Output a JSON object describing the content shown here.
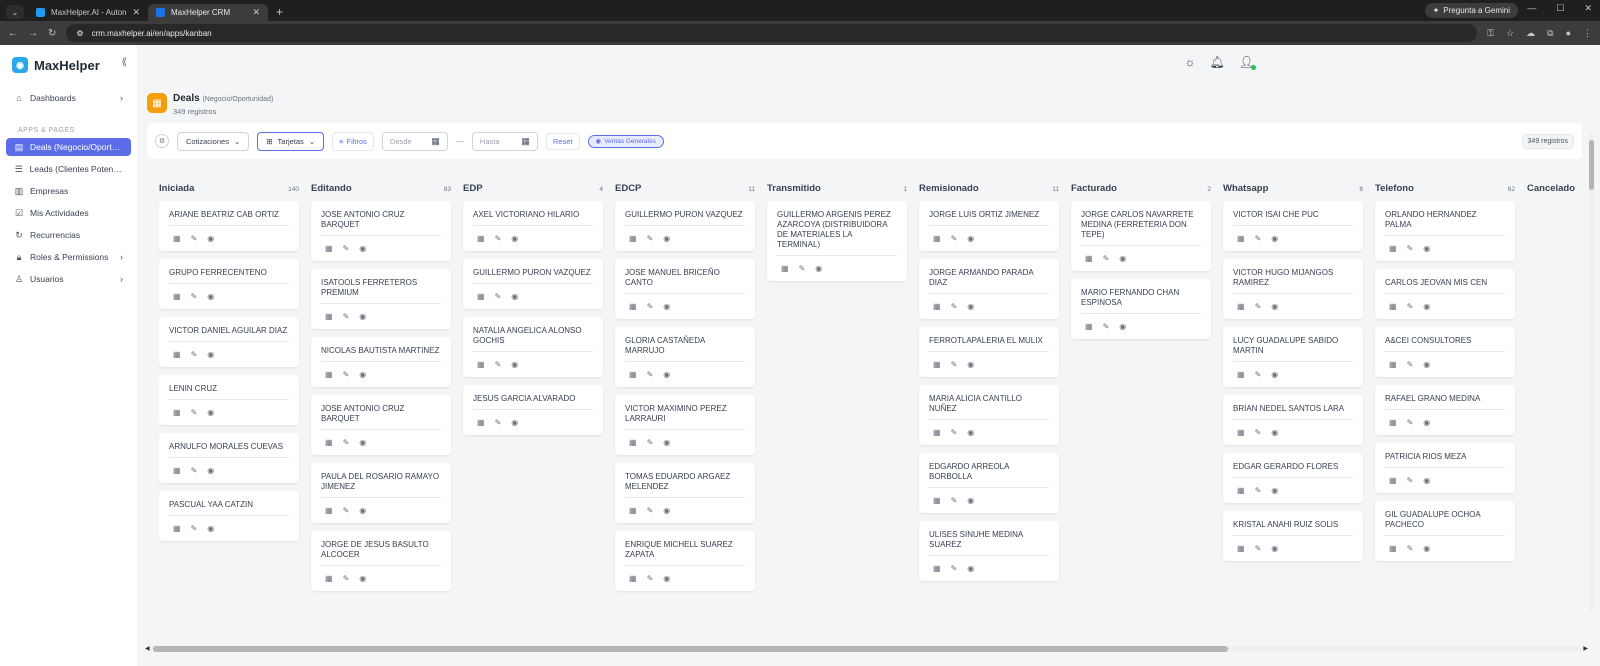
{
  "browser": {
    "tabs": [
      {
        "title": "MaxHelper.AI - Automatiza tu ...",
        "active": false
      },
      {
        "title": "MaxHelper CRM",
        "active": true
      }
    ],
    "gemini_label": "Pregunta a Gemini",
    "url": "crm.maxhelper.ai/en/apps/kanban"
  },
  "sidebar": {
    "brand": "MaxHelper",
    "dashboards": "Dashboards",
    "section_label": "APPS & PAGES",
    "items": [
      {
        "label": "Deals (Negocio/Oportu...",
        "icon": "store-icon"
      },
      {
        "label": "Leads (Clientes Potenci...",
        "icon": "list-icon"
      },
      {
        "label": "Empresas",
        "icon": "building-icon"
      },
      {
        "label": "Mis Actividades",
        "icon": "checkbox-icon"
      },
      {
        "label": "Recurrencias",
        "icon": "refresh-icon"
      },
      {
        "label": "Roles & Permissions",
        "icon": "lock-icon"
      },
      {
        "label": "Usuarios",
        "icon": "user-icon"
      }
    ]
  },
  "header": {
    "title": "Deals",
    "subtitle": "(Negocio/Oportunidad)",
    "count": "349 registros"
  },
  "toolbar": {
    "quotes": "Cotizaciones",
    "view": "Tarjetas",
    "filters": "Filtros",
    "from_placeholder": "Desde",
    "to_placeholder": "Hasta",
    "reset": "Reset",
    "chip": "Ventas Generales",
    "total": "349 registros"
  },
  "columns": [
    {
      "title": "Iniciada",
      "count": "140",
      "cards": [
        "ARIANE BEATRIZ CAB ORTIZ",
        "GRUPO FERRECENTENO",
        "VICTOR DANIEL AGUILAR DIAZ",
        "LENIN CRUZ",
        "ARNULFO MORALES CUEVAS",
        "PASCUAL YAA CATZIN"
      ]
    },
    {
      "title": "Editando",
      "count": "83",
      "cards": [
        "JOSE ANTONIO CRUZ BARQUET",
        "ISATOOLS FERRETEROS PREMIUM",
        "NICOLAS BAUTISTA MARTINEZ",
        "JOSE ANTONIO CRUZ BARQUET",
        "PAULA DEL ROSARIO RAMAYO JIMENEZ",
        "JORGE DE JESUS BASULTO ALCOCER"
      ]
    },
    {
      "title": "EDP",
      "count": "4",
      "cards": [
        "AXEL VICTORIANO HILARIO",
        "GUILLERMO PURON VAZQUEZ",
        "NATALIA ANGELICA ALONSO GOCHIS",
        "JESUS GARCIA ALVARADO"
      ]
    },
    {
      "title": "EDCP",
      "count": "11",
      "cards": [
        "GUILLERMO PURON VAZQUEZ",
        "JOSE MANUEL BRICEÑO CANTO",
        "GLORIA CASTAÑEDA MARRUJO",
        "VICTOR MAXIMINO PEREZ LARRAURI",
        "TOMAS EDUARDO ARGAEZ MELENDEZ",
        "ENRIQUE MICHELL SUAREZ ZAPATA"
      ]
    },
    {
      "title": "Transmitido",
      "count": "1",
      "cards": [
        "GUILLERMO ARGENIS PEREZ AZARCOYA (DISTRIBUIDORA DE MATERIALES LA TERMINAL)"
      ]
    },
    {
      "title": "Remisionado",
      "count": "11",
      "cards": [
        "JORGE LUIS ORTIZ JIMENEZ",
        "JORGE ARMANDO PARADA DIAZ",
        "FERROTLAPALERIA EL MULIX",
        "MARIA ALICIA CANTILLO NUÑEZ",
        "EDGARDO ARREOLA BORBOLLA",
        "ULISES SINUHE MEDINA SUAREZ"
      ]
    },
    {
      "title": "Facturado",
      "count": "2",
      "cards": [
        "JORGE CARLOS NAVARRETE MEDINA (FERRETERIA DON TEPE)",
        "MARIO FERNANDO CHAN ESPINOSA"
      ]
    },
    {
      "title": "Whatsapp",
      "count": "8",
      "cards": [
        "VICTOR ISAI CHE PUC",
        "VICTOR HUGO MIJANGOS RAMIREZ",
        "LUCY GUADALUPE SABIDO MARTIN",
        "BRIAN NEDEL SANTOS LARA",
        "EDGAR GERARDO FLORES",
        "KRISTAL ANAHI RUIZ SOLIS"
      ]
    },
    {
      "title": "Telefono",
      "count": "62",
      "cards": [
        "ORLANDO HERNANDEZ PALMA",
        "CARLOS JEOVAN MIS CEN",
        "A&CEI CONSULTORES",
        "RAFAEL GRANO MEDINA",
        "PATRICIA RIOS MEZA",
        "GIL GUADALUPE OCHOA PACHECO"
      ]
    },
    {
      "title": "Cancelado",
      "count": "",
      "cards": []
    }
  ]
}
